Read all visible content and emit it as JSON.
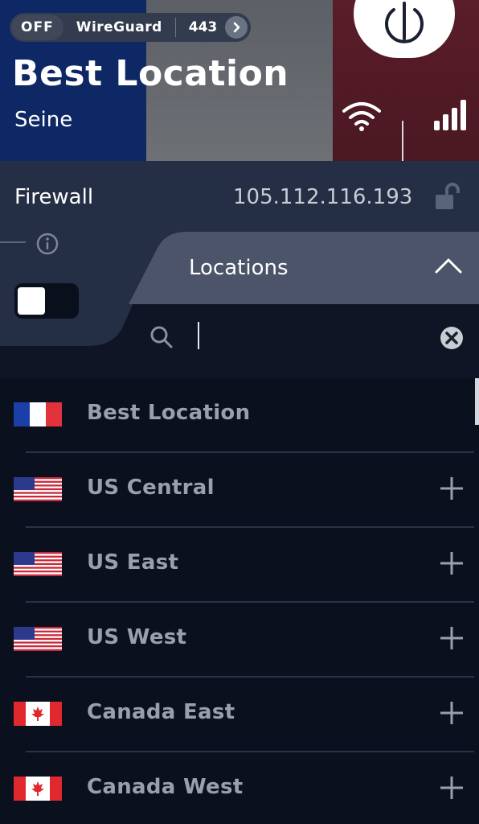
{
  "status": {
    "state": "OFF",
    "protocol": "WireGuard",
    "port": "443"
  },
  "header": {
    "title": "Best Location",
    "subtitle": "Seine"
  },
  "firewall": {
    "label": "Firewall",
    "ip": "105.112.116.193",
    "toggle_on": true
  },
  "locations_panel": {
    "title": "Locations",
    "search_placeholder": ""
  },
  "locations": [
    {
      "name": "Best Location",
      "flag": "france-flag",
      "expandable": false
    },
    {
      "name": "US Central",
      "flag": "us-flag",
      "expandable": true
    },
    {
      "name": "US East",
      "flag": "us-flag",
      "expandable": true
    },
    {
      "name": "US West",
      "flag": "us-flag",
      "expandable": true
    },
    {
      "name": "Canada East",
      "flag": "canada-flag",
      "expandable": true
    },
    {
      "name": "Canada West",
      "flag": "canada-flag",
      "expandable": true
    }
  ],
  "colors": {
    "background": "#0c1220",
    "header_blue": "#0e2866",
    "header_red": "#5a1d2a",
    "panel": "#242e44",
    "list_text": "#9aa0ab"
  }
}
